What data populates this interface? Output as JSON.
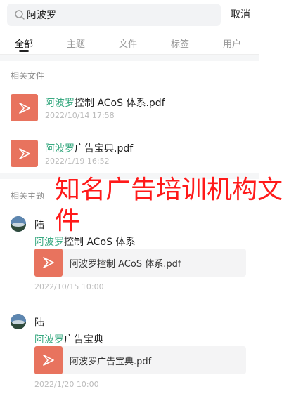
{
  "search": {
    "value": "阿波罗",
    "cancel_label": "取消"
  },
  "tabs": [
    {
      "label": "全部"
    },
    {
      "label": "主题"
    },
    {
      "label": "文件"
    },
    {
      "label": "标签"
    },
    {
      "label": "用户"
    }
  ],
  "files_section": {
    "label": "相关文件",
    "items": [
      {
        "highlight": "阿波罗",
        "rest": "控制 ACoS 体系.pdf",
        "time": "2022/10/14 17:58"
      },
      {
        "highlight": "阿波罗",
        "rest": "广告宝典.pdf",
        "time": "2022/1/19 16:52"
      }
    ]
  },
  "topics_section": {
    "label": "相关主题",
    "items": [
      {
        "author": "陆",
        "title_highlight": "阿波罗",
        "title_rest": "控制 ACoS 体系",
        "attachment": "阿波罗控制 ACoS 体系.pdf",
        "time": "2022/10/15 10:00"
      },
      {
        "author": "陆",
        "title_highlight": "阿波罗",
        "title_rest": "广告宝典",
        "attachment": "阿波罗广告宝典.pdf",
        "time": "2022/1/20 10:00"
      }
    ]
  },
  "overlay_text": "知名广告培训机构文件",
  "colors": {
    "highlight": "#3aaa82",
    "file_thumb": "#e8735e",
    "overlay": "#ff1a1a"
  }
}
